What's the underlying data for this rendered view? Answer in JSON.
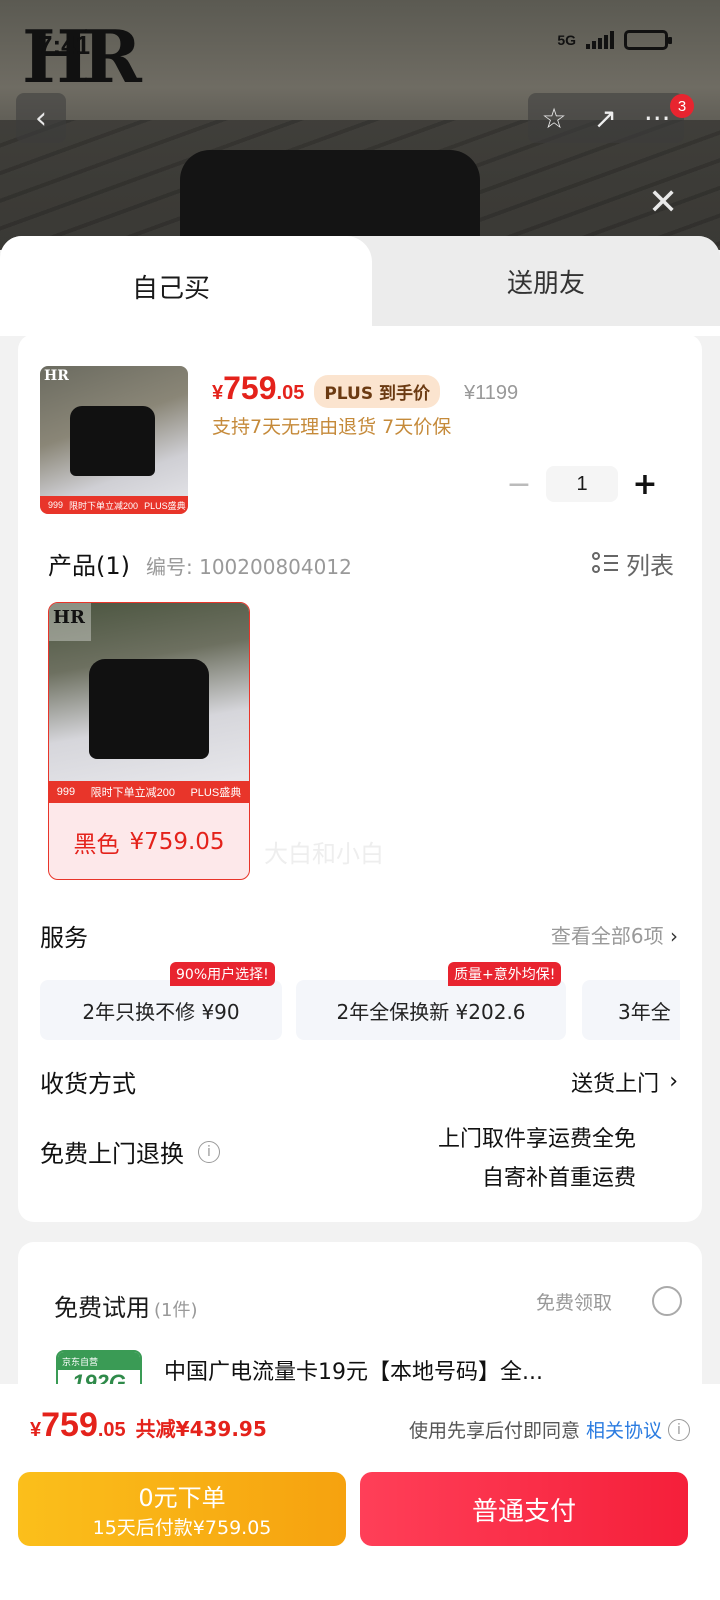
{
  "status_bar": {
    "time": "7:41",
    "network": "5G"
  },
  "header": {
    "brand": "HR",
    "notification_count": "3",
    "icons": [
      "back-chevron-icon",
      "star-icon",
      "share-icon",
      "more-icon",
      "close-icon"
    ]
  },
  "tabs": [
    {
      "label": "自己买",
      "selected": true
    },
    {
      "label": "送朋友",
      "selected": false
    }
  ],
  "product": {
    "price_currency": "¥",
    "price_int": "759",
    "price_dec": ".05",
    "plus_tag": "PLUS 到手价",
    "original_price": "¥1199",
    "promise": "支持7天无理由退货  7天价保",
    "thumb_strip_price": "999",
    "thumb_strip_text": "限时下单立减200",
    "thumb_strip_tag": "PLUS盛典",
    "quantity": "1"
  },
  "products_section": {
    "title": "产品(1)",
    "code": "编号: 100200804012",
    "list_label": "列表",
    "variant": {
      "strip_price": "999",
      "strip_text": "限时下单立减200",
      "strip_tag": "PLUS盛典",
      "color": "黑色",
      "price": "¥759.05"
    },
    "watermark": "大白和小白"
  },
  "services": {
    "title": "服务",
    "view_all": "查看全部6项",
    "items": [
      {
        "label": "2年只换不修  ¥90",
        "tag": "90%用户选择!"
      },
      {
        "label": "2年全保换新  ¥202.6",
        "tag": "质量+意外均保!"
      },
      {
        "label": "3年全",
        "tag": ""
      }
    ]
  },
  "delivery": {
    "label": "收货方式",
    "value": "送货上门"
  },
  "free_return": {
    "label": "免费上门退换",
    "line1": "上门取件享运费全免",
    "line2": "自寄补首重运费"
  },
  "trial": {
    "title": "免费试用",
    "count": "(1件)",
    "get_label": "免费领取",
    "item_name": "中国广电流量卡19元【本地号码】全...",
    "card_gb": "192G",
    "card_brand": "京东自营"
  },
  "bottom_bar": {
    "total_currency": "¥",
    "total_int": "759",
    "total_dec": ".05",
    "savings": "共减¥439.95",
    "agree_text": "使用先享后付即同意",
    "agree_link": "相关协议",
    "later_line1": "0元下单",
    "later_line2": "15天后付款¥759.05",
    "pay_label": "普通支付"
  },
  "colors": {
    "accent_red": "#e4221b",
    "pay_red": "#f51f3a",
    "later_yellow": "#f6a20f",
    "link_blue": "#2a7be0"
  }
}
